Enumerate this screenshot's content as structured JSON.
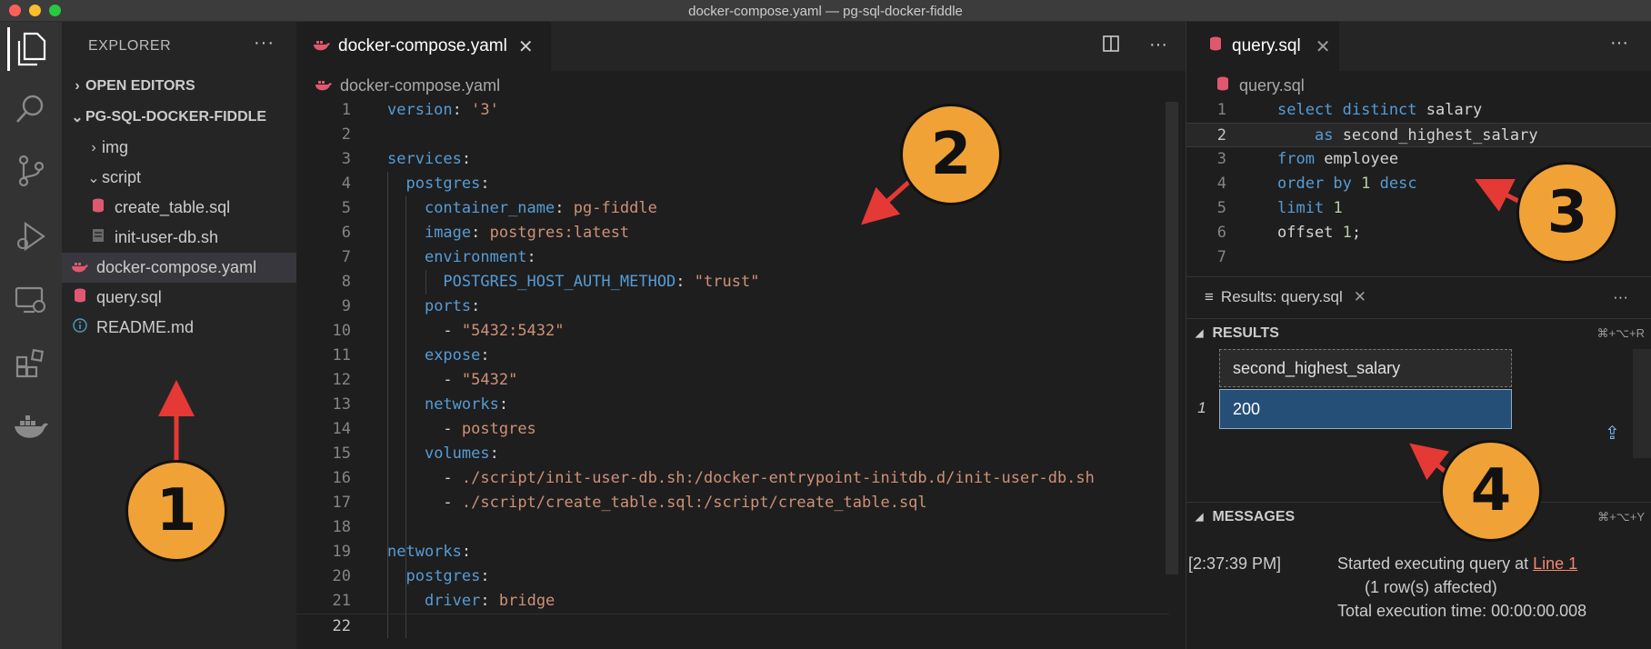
{
  "window": {
    "title": "docker-compose.yaml — pg-sql-docker-fiddle"
  },
  "colors": {
    "accent": "#569cd6",
    "badge": "#f0a236",
    "arrow": "#e53935",
    "selected_cell": "#264f78"
  },
  "activity_bar": {
    "items": [
      {
        "icon": "files-icon"
      },
      {
        "icon": "search-icon"
      },
      {
        "icon": "source-control-icon"
      },
      {
        "icon": "run-debug-icon"
      },
      {
        "icon": "remote-explorer-icon"
      },
      {
        "icon": "extensions-icon"
      },
      {
        "icon": "docker-icon"
      }
    ]
  },
  "sidebar": {
    "title": "EXPLORER",
    "more": "···",
    "open_editors": "OPEN EDITORS",
    "project": "PG-SQL-DOCKER-FIDDLE",
    "tree": [
      {
        "label": "img",
        "type": "folder-collapsed"
      },
      {
        "label": "script",
        "type": "folder-expanded"
      },
      {
        "label": "create_table.sql",
        "type": "sql"
      },
      {
        "label": "init-user-db.sh",
        "type": "shell"
      },
      {
        "label": "docker-compose.yaml",
        "type": "docker",
        "selected": true
      },
      {
        "label": "query.sql",
        "type": "sql"
      },
      {
        "label": "README.md",
        "type": "info"
      }
    ]
  },
  "editor": {
    "tab_label": "docker-compose.yaml",
    "breadcrumb": "docker-compose.yaml",
    "more": "···",
    "lines": [
      "1",
      "2",
      "3",
      "4",
      "5",
      "6",
      "7",
      "8",
      "9",
      "10",
      "11",
      "12",
      "13",
      "14",
      "15",
      "16",
      "17",
      "18",
      "19",
      "20",
      "21",
      "22"
    ],
    "code": {
      "l1_key": "version",
      "l1_val": "'3'",
      "l3_key": "services",
      "l4_key": "postgres",
      "l5_key": "container_name",
      "l5_val": "pg-fiddle",
      "l6_key": "image",
      "l6_val": "postgres:latest",
      "l7_key": "environment",
      "l8_key": "POSTGRES_HOST_AUTH_METHOD",
      "l8_val": "\"trust\"",
      "l9_key": "ports",
      "l10_val": "\"5432:5432\"",
      "l11_key": "expose",
      "l12_val": "\"5432\"",
      "l13_key": "networks",
      "l14_val": "postgres",
      "l15_key": "volumes",
      "l16_val": "./script/init-user-db.sh:/docker-entrypoint-initdb.d/init-user-db.sh",
      "l17_val": "./script/create_table.sql:/script/create_table.sql",
      "l19_key": "networks",
      "l20_key": "postgres",
      "l21_key": "driver",
      "l21_val": "bridge",
      "dash": "- ",
      "colon": ":"
    }
  },
  "sql_editor": {
    "tab_label": "query.sql",
    "breadcrumb": "query.sql",
    "more": "···",
    "lines": [
      "1",
      "2",
      "3",
      "4",
      "5",
      "6",
      "7"
    ],
    "code": {
      "l1_kw": "select distinct",
      "l1_id": "salary",
      "l2_kw": "as",
      "l2_id": "second_highest_salary",
      "l3_kw": "from",
      "l3_id": "employee",
      "l4_kw": "order by",
      "l4_num": "1",
      "l4_kw2": "desc",
      "l5_kw": "limit",
      "l5_num": "1",
      "l6_id": "offset",
      "l6_num": "1",
      "l6_end": ";"
    }
  },
  "results": {
    "tab_label": "Results: query.sql",
    "more": "···",
    "results_section": "RESULTS",
    "results_shortcut": "⌘+⌥+R",
    "column": "second_highest_salary",
    "row_number": "1",
    "value": "200",
    "messages_section": "MESSAGES",
    "messages_shortcut": "⌘+⌥+Y",
    "msg_time": "[2:37:39 PM]",
    "msg_started": "Started executing query at ",
    "msg_link": "Line 1",
    "msg_rows": "(1 row(s) affected)",
    "msg_total": "Total execution time: 00:00:00.008"
  },
  "annotations": [
    "1",
    "2",
    "3",
    "4"
  ]
}
